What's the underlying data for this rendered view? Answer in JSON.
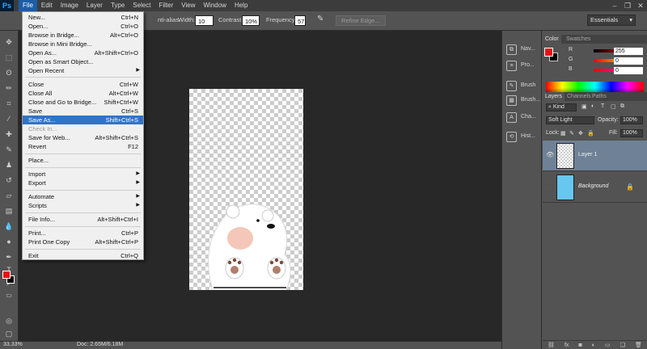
{
  "menubar": {
    "logo": "Ps",
    "items": [
      "File",
      "Edit",
      "Image",
      "Layer",
      "Type",
      "Select",
      "Filter",
      "View",
      "Window",
      "Help"
    ],
    "active_index": 0
  },
  "options_bar": {
    "anti_alias_label": "nti-alias",
    "width_label": "Width:",
    "width_value": "10 px",
    "contrast_label": "Contrast:",
    "contrast_value": "10%",
    "frequency_label": "Frequency:",
    "frequency_value": "57",
    "refine_edge_label": "Refine Edge...",
    "workspace_label": "Essentials"
  },
  "file_menu": [
    {
      "label": "New...",
      "shortcut": "Ctrl+N"
    },
    {
      "label": "Open...",
      "shortcut": "Ctrl+O"
    },
    {
      "label": "Browse in Bridge...",
      "shortcut": "Alt+Ctrl+O"
    },
    {
      "label": "Browse in Mini Bridge...",
      "shortcut": ""
    },
    {
      "label": "Open As...",
      "shortcut": "Alt+Shift+Ctrl+O"
    },
    {
      "label": "Open as Smart Object...",
      "shortcut": ""
    },
    {
      "label": "Open Recent",
      "shortcut": ""
    },
    {
      "label": "Close",
      "shortcut": "Ctrl+W"
    },
    {
      "label": "Close All",
      "shortcut": "Alt+Ctrl+W"
    },
    {
      "label": "Close and Go to Bridge...",
      "shortcut": "Shift+Ctrl+W"
    },
    {
      "label": "Save",
      "shortcut": "Ctrl+S"
    },
    {
      "label": "Save As...",
      "shortcut": "Shift+Ctrl+S"
    },
    {
      "label": "Check In...",
      "shortcut": ""
    },
    {
      "label": "Save for Web...",
      "shortcut": "Alt+Shift+Ctrl+S"
    },
    {
      "label": "Revert",
      "shortcut": "F12"
    },
    {
      "label": "Place...",
      "shortcut": ""
    },
    {
      "label": "Import",
      "shortcut": ""
    },
    {
      "label": "Export",
      "shortcut": ""
    },
    {
      "label": "Automate",
      "shortcut": ""
    },
    {
      "label": "Scripts",
      "shortcut": ""
    },
    {
      "label": "File Info...",
      "shortcut": "Alt+Shift+Ctrl+I"
    },
    {
      "label": "Print...",
      "shortcut": "Ctrl+P"
    },
    {
      "label": "Print One Copy",
      "shortcut": "Alt+Shift+Ctrl+P"
    },
    {
      "label": "Exit",
      "shortcut": "Ctrl+Q"
    }
  ],
  "mini_panel": {
    "items": [
      "Nav...",
      "Pro...",
      "Brush",
      "Brush...",
      "Cha...",
      "Hist..."
    ]
  },
  "color_panel": {
    "tabs": [
      "Color",
      "Swatches"
    ],
    "r_label": "R",
    "r_value": "255",
    "g_label": "G",
    "g_value": "0",
    "b_label": "B",
    "b_value": "0",
    "foreground": "#e51212",
    "background": "#000000"
  },
  "layers_panel": {
    "tabs": [
      "Layers",
      "Channels",
      "Paths"
    ],
    "kind_label": "Kind",
    "blend_mode": "Soft Light",
    "opacity_label": "Opacity:",
    "opacity_value": "100%",
    "lock_label": "Lock:",
    "fill_label": "Fill:",
    "fill_value": "100%",
    "layers": [
      {
        "name": "Layer 1",
        "selected": true
      },
      {
        "name": "Background",
        "selected": false
      }
    ]
  },
  "status": {
    "zoom": "33.33%",
    "doc_info": "Doc: 2.65M/6.18M"
  }
}
